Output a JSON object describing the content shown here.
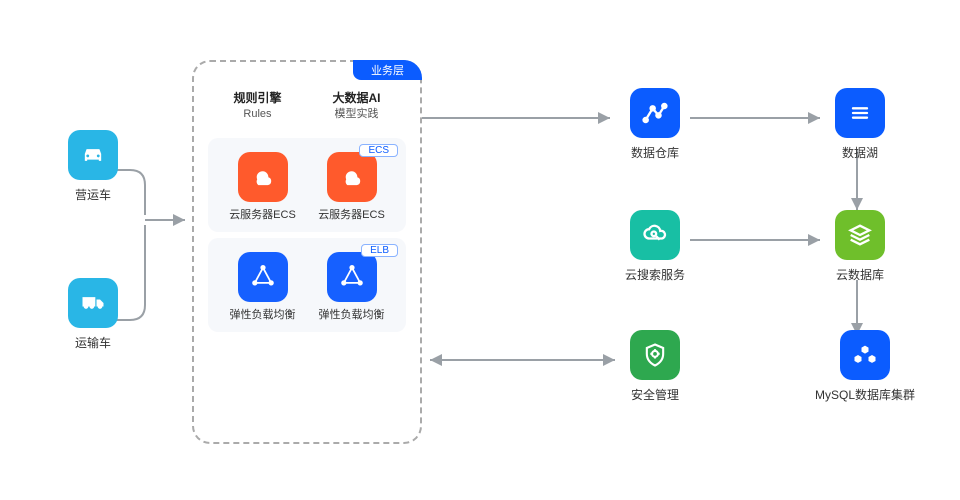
{
  "left": {
    "car": {
      "label": "营运车"
    },
    "truck": {
      "label": "运输车"
    }
  },
  "center": {
    "tab": "业务层",
    "headers": [
      {
        "line1": "规则引擎",
        "line2": "Rules"
      },
      {
        "line1": "大数据AI",
        "line2": "模型实践"
      }
    ],
    "ecs": {
      "badge": "ECS",
      "label1": "云服务器ECS",
      "label2": "云服务器ECS"
    },
    "elb": {
      "badge": "ELB",
      "label1": "弹性负载均衡",
      "label2": "弹性负载均衡"
    }
  },
  "right": {
    "dws": {
      "label": "数据仓库"
    },
    "mrs": {
      "label": "数据湖"
    },
    "search": {
      "label": "云搜索服务"
    },
    "cloudtb": {
      "label": "云数据库"
    },
    "safe": {
      "label": "安全管理"
    },
    "mysql": {
      "label": "MySQL数据库集群"
    }
  }
}
